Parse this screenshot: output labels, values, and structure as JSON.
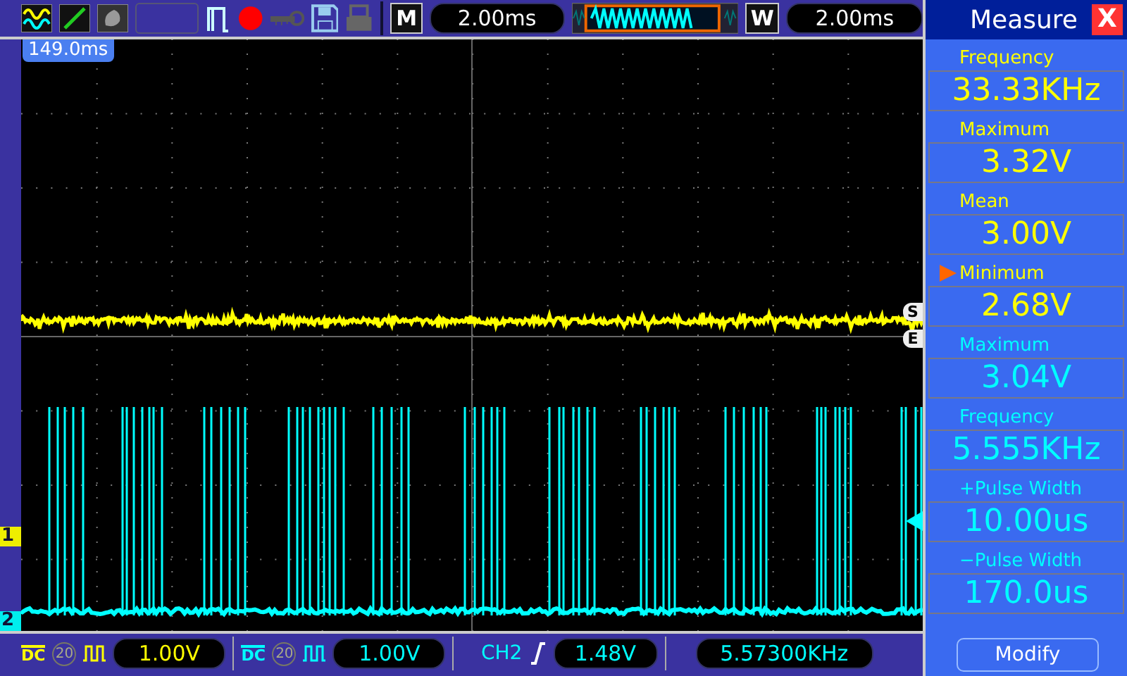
{
  "toolbar": {
    "memory_label": "M",
    "main_timebase": "2.00ms",
    "window_label": "W",
    "window_timebase": "2.00ms",
    "recording": true
  },
  "screen": {
    "trigger_position": "149.0ms",
    "start_marker": "S",
    "end_marker": "E",
    "channel_markers": [
      "1",
      "2"
    ]
  },
  "measure_panel": {
    "title": "Measure",
    "close": "X",
    "items": [
      {
        "label": "Frequency",
        "value": "33.33KHz",
        "color": "#ffff00",
        "selected": false
      },
      {
        "label": "Maximum",
        "value": "3.32V",
        "color": "#ffff00",
        "selected": false
      },
      {
        "label": "Mean",
        "value": "3.00V",
        "color": "#ffff00",
        "selected": false
      },
      {
        "label": "Minimum",
        "value": "2.68V",
        "color": "#ffff00",
        "selected": true
      },
      {
        "label": "Maximum",
        "value": "3.04V",
        "color": "#00ffff",
        "selected": false
      },
      {
        "label": "Frequency",
        "value": "5.555KHz",
        "color": "#00ffff",
        "selected": false
      },
      {
        "label": "+Pulse Width",
        "value": "10.00us",
        "color": "#00ffff",
        "selected": false
      },
      {
        "label": "−Pulse Width",
        "value": "170.0us",
        "color": "#00ffff",
        "selected": false
      }
    ],
    "modify_button": "Modify"
  },
  "status_bar": {
    "channels": [
      {
        "coupling": "DC",
        "bandwidth": "20",
        "volts": "1.00V",
        "color": "#ffff00"
      },
      {
        "coupling": "DC",
        "bandwidth": "20",
        "volts": "1.00V",
        "color": "#00ffff"
      }
    ],
    "trigger_source": "CH2",
    "trigger_level": "1.48V",
    "frequency": "5.57300KHz"
  }
}
